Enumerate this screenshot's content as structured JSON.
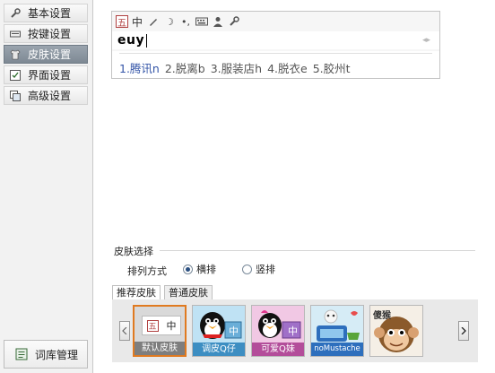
{
  "sidebar": {
    "items": [
      {
        "label": "基本设置",
        "icon": "wrench-icon"
      },
      {
        "label": "按键设置",
        "icon": "keyboard-icon"
      },
      {
        "label": "皮肤设置",
        "icon": "shirt-icon"
      },
      {
        "label": "界面设置",
        "icon": "window-icon"
      },
      {
        "label": "高级设置",
        "icon": "advanced-icon"
      }
    ],
    "bottom_button": {
      "label": "词库管理",
      "icon": "dictionary-icon"
    }
  },
  "preview": {
    "toolbar": {
      "logo": "五",
      "mode": "中",
      "moon": "☽",
      "punct": "•,"
    },
    "input_text": "euy",
    "candidates": [
      "1.腾讯n",
      "2.脱离b",
      "3.服装店h",
      "4.脱衣e",
      "5.胶州t"
    ],
    "pager_glyph": "◂▸"
  },
  "skin_select": {
    "section_title": "皮肤选择",
    "sort_label": "排列方式",
    "sort_options": [
      {
        "label": "横排",
        "selected": true
      },
      {
        "label": "竖排",
        "selected": false
      }
    ],
    "tabs": [
      {
        "label": "推荐皮肤",
        "active": true
      },
      {
        "label": "普通皮肤",
        "active": false
      }
    ],
    "thumbs": [
      {
        "label": "默认皮肤",
        "selected": true,
        "logo": "五",
        "mode": "中"
      },
      {
        "label": "调皮Q仔",
        "selected": false,
        "mode": "中"
      },
      {
        "label": "可爱Q妹",
        "selected": false,
        "mode": "中"
      },
      {
        "label": "noMustache",
        "selected": false
      },
      {
        "label": "傻猴",
        "selected": false
      }
    ]
  },
  "colors": {
    "accent_orange": "#e07a20",
    "candidate_blue": "#3556a8",
    "active_nav": "#8a949e"
  }
}
